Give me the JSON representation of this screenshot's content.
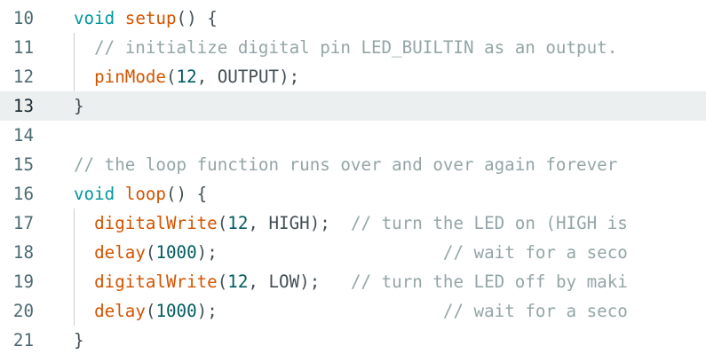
{
  "editor": {
    "current_line": "13",
    "lines": [
      {
        "number": "10",
        "tokens": [
          {
            "type": "kw",
            "text": "void"
          },
          {
            "type": "pl",
            "text": " "
          },
          {
            "type": "fn",
            "text": "setup"
          },
          {
            "type": "pl",
            "text": "() {"
          }
        ]
      },
      {
        "number": "11",
        "tokens": [
          {
            "type": "cm",
            "text": "  // initialize digital pin LED_BUILTIN as an output."
          }
        ]
      },
      {
        "number": "12",
        "tokens": [
          {
            "type": "pl",
            "text": "  "
          },
          {
            "type": "fn",
            "text": "pinMode"
          },
          {
            "type": "pl",
            "text": "("
          },
          {
            "type": "num",
            "text": "12"
          },
          {
            "type": "pl",
            "text": ", OUTPUT);"
          }
        ]
      },
      {
        "number": "13",
        "tokens": [
          {
            "type": "pl",
            "text": "}"
          }
        ]
      },
      {
        "number": "14",
        "tokens": []
      },
      {
        "number": "15",
        "tokens": [
          {
            "type": "cm",
            "text": "// the loop function runs over and over again forever"
          }
        ]
      },
      {
        "number": "16",
        "tokens": [
          {
            "type": "kw",
            "text": "void"
          },
          {
            "type": "pl",
            "text": " "
          },
          {
            "type": "fn",
            "text": "loop"
          },
          {
            "type": "pl",
            "text": "() {"
          }
        ]
      },
      {
        "number": "17",
        "tokens": [
          {
            "type": "pl",
            "text": "  "
          },
          {
            "type": "fn",
            "text": "digitalWrite"
          },
          {
            "type": "pl",
            "text": "("
          },
          {
            "type": "num",
            "text": "12"
          },
          {
            "type": "pl",
            "text": ", HIGH);  "
          },
          {
            "type": "cm",
            "text": "// turn the LED on (HIGH is"
          }
        ]
      },
      {
        "number": "18",
        "tokens": [
          {
            "type": "pl",
            "text": "  "
          },
          {
            "type": "fn",
            "text": "delay"
          },
          {
            "type": "pl",
            "text": "("
          },
          {
            "type": "num",
            "text": "1000"
          },
          {
            "type": "pl",
            "text": ");                      "
          },
          {
            "type": "cm",
            "text": "// wait for a seco"
          }
        ]
      },
      {
        "number": "19",
        "tokens": [
          {
            "type": "pl",
            "text": "  "
          },
          {
            "type": "fn",
            "text": "digitalWrite"
          },
          {
            "type": "pl",
            "text": "("
          },
          {
            "type": "num",
            "text": "12"
          },
          {
            "type": "pl",
            "text": ", LOW);   "
          },
          {
            "type": "cm",
            "text": "// turn the LED off by maki"
          }
        ]
      },
      {
        "number": "20",
        "tokens": [
          {
            "type": "pl",
            "text": "  "
          },
          {
            "type": "fn",
            "text": "delay"
          },
          {
            "type": "pl",
            "text": "("
          },
          {
            "type": "num",
            "text": "1000"
          },
          {
            "type": "pl",
            "text": ");                      "
          },
          {
            "type": "cm",
            "text": "// wait for a seco"
          }
        ]
      },
      {
        "number": "21",
        "tokens": [
          {
            "type": "pl",
            "text": "}"
          }
        ]
      }
    ]
  }
}
